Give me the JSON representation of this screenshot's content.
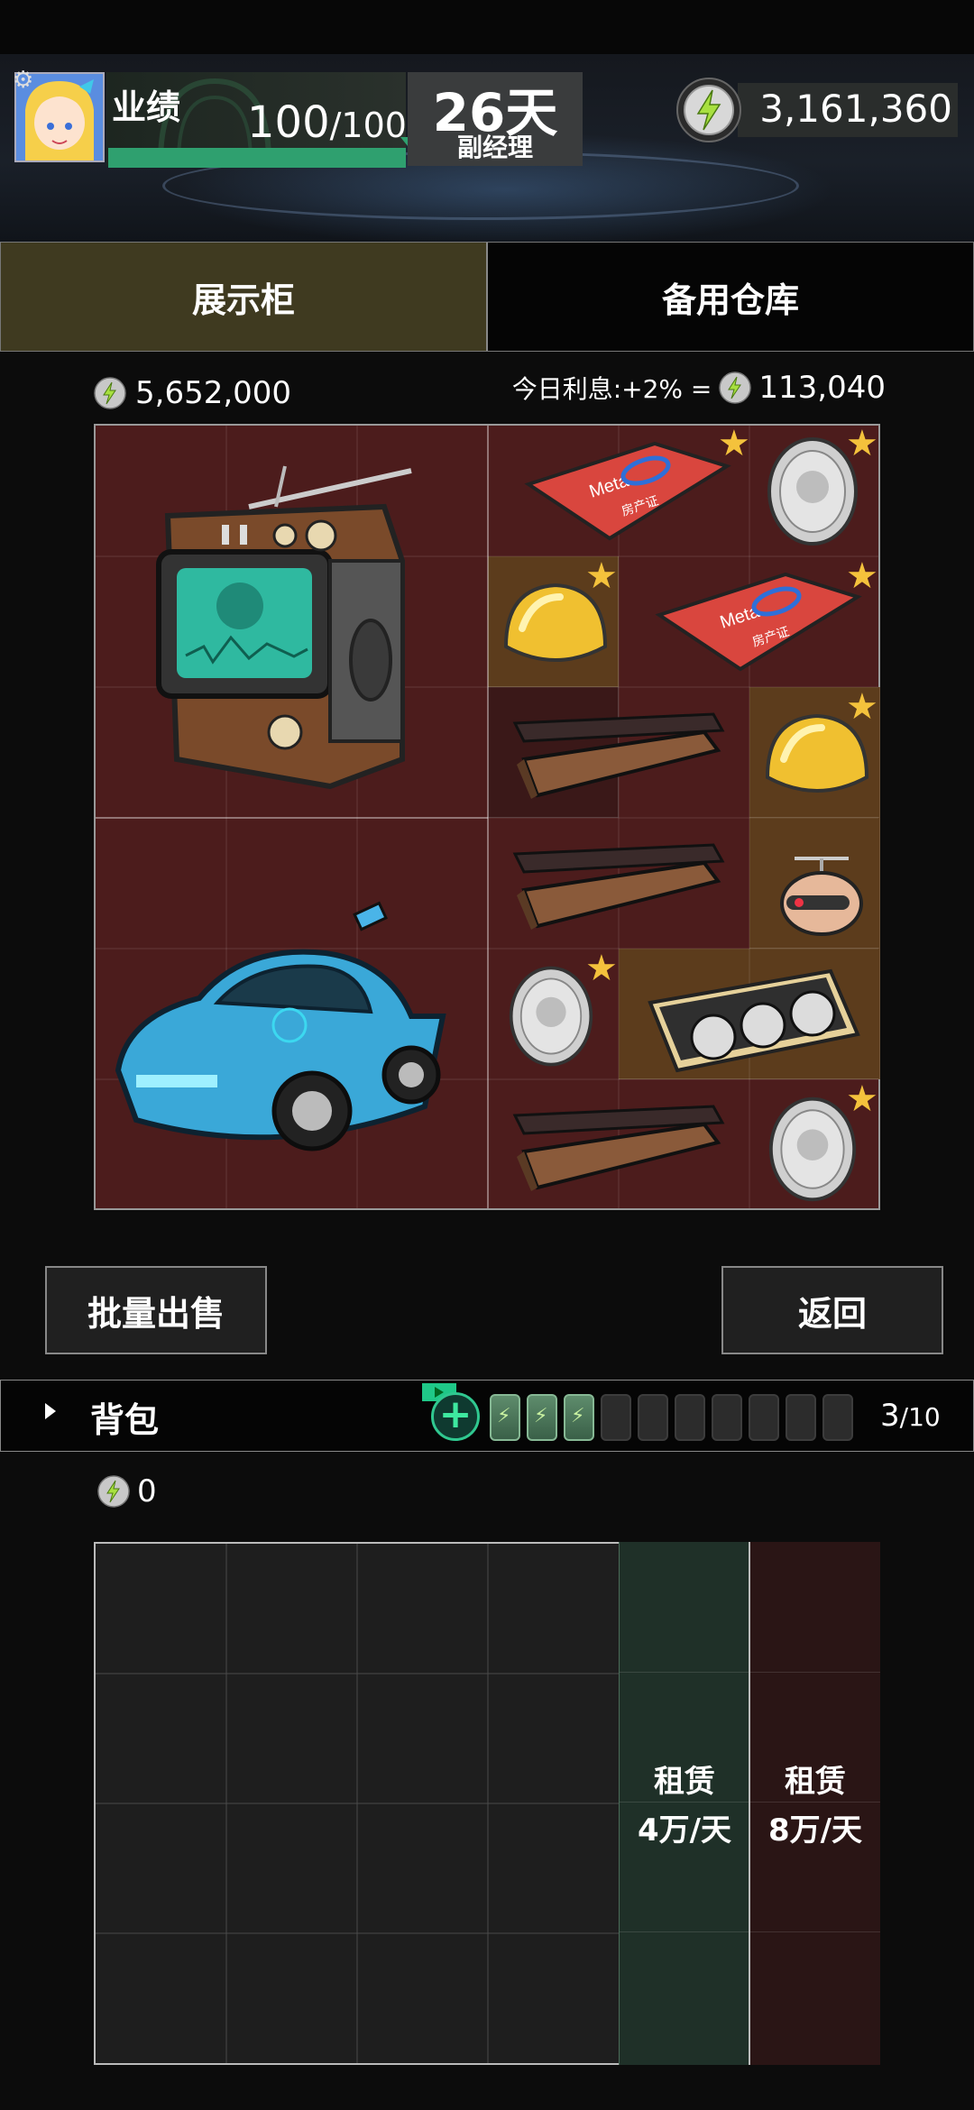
{
  "hud": {
    "performance_label": "业绩",
    "performance_value": "100",
    "performance_max": "/100",
    "day_label": "26天",
    "rank_label": "副经理",
    "coin_total": "3,161,360",
    "performance_progress": 1.0
  },
  "tabs": {
    "showcase": "展示柜",
    "warehouse": "备用仓库"
  },
  "showcase": {
    "total_value": "5,652,000",
    "interest_label": "今日利息:+2% =",
    "interest_value": "113,040",
    "items": [
      {
        "name": "retro-tv",
        "icon": "retro-tv-icon"
      },
      {
        "name": "meta-property-deed",
        "icon": "deed-icon",
        "text": "Meta 房产证",
        "starred": true
      },
      {
        "name": "silver-coin",
        "icon": "silver-coin-icon",
        "starred": true
      },
      {
        "name": "gold-ingot",
        "icon": "gold-ingot-icon",
        "starred": true
      },
      {
        "name": "meta-property-deed",
        "icon": "deed-icon",
        "text": "Meta 房产证",
        "starred": true
      },
      {
        "name": "bronze-bar",
        "icon": "bronze-bar-icon"
      },
      {
        "name": "gold-ingot",
        "icon": "gold-ingot-icon",
        "starred": true
      },
      {
        "name": "bronze-bar",
        "icon": "bronze-bar-icon"
      },
      {
        "name": "robot-head",
        "icon": "robot-head-icon"
      },
      {
        "name": "blue-sports-car",
        "icon": "sports-car-icon"
      },
      {
        "name": "silver-coin",
        "icon": "silver-coin-icon",
        "starred": true
      },
      {
        "name": "graphics-card",
        "icon": "gpu-icon"
      },
      {
        "name": "bronze-bar",
        "icon": "bronze-bar-icon"
      },
      {
        "name": "silver-coin",
        "icon": "silver-coin-icon",
        "starred": true
      }
    ]
  },
  "buttons": {
    "bulk_sell": "批量出售",
    "back": "返回"
  },
  "backpack": {
    "title": "背包",
    "count": "3",
    "capacity": "/10",
    "filled_slots": 3,
    "total_slots": 10,
    "coin_value": "0",
    "rent_green_label": "租赁",
    "rent_green_price": "4万/天",
    "rent_red_label": "租赁",
    "rent_red_price": "8万/天"
  },
  "colors": {
    "accent_green": "#2fa06f",
    "showcase_bg": "#4c1c1c",
    "star_gold": "#f4c23c"
  }
}
